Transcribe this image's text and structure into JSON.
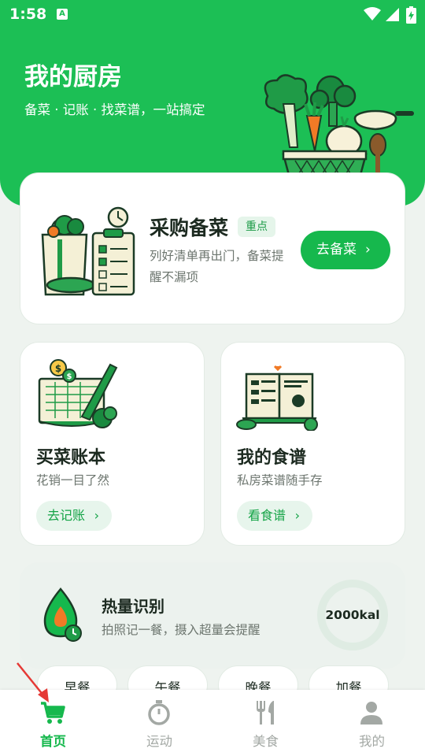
{
  "status_bar": {
    "time": "1:58",
    "notification_badge": "A"
  },
  "header": {
    "title": "我的厨房",
    "subtitle": "备菜 · 记账 · 找菜谱，一站搞定"
  },
  "shopping_card": {
    "title": "采购备菜",
    "tag": "重点",
    "description": "列好清单再出门，备菜提醒不漏项",
    "button_label": "去备菜",
    "button_chevron": "›"
  },
  "ledger_card": {
    "title": "买菜账本",
    "description": "花销一目了然",
    "button_label": "去记账",
    "button_chevron": "›"
  },
  "recipe_card": {
    "title": "我的食谱",
    "description": "私房菜谱随手存",
    "button_label": "看食谱",
    "button_chevron": "›"
  },
  "calorie_card": {
    "title": "热量识别",
    "description": "拍照记一餐，摄入超量会提醒",
    "calorie_value": "2000kal"
  },
  "meal_tabs": [
    "早餐",
    "午餐",
    "晚餐",
    "加餐"
  ],
  "bottom_nav": [
    {
      "label": "首页",
      "icon": "cart-icon",
      "active": true
    },
    {
      "label": "运动",
      "icon": "stopwatch-icon",
      "active": false
    },
    {
      "label": "美食",
      "icon": "fork-knife-icon",
      "active": false
    },
    {
      "label": "我的",
      "icon": "person-icon",
      "active": false
    }
  ],
  "colors": {
    "brand": "#1cbf55",
    "accent_dark": "#16b84d",
    "tag_bg": "#e5f5ea",
    "inactive": "#a3a8a4"
  }
}
